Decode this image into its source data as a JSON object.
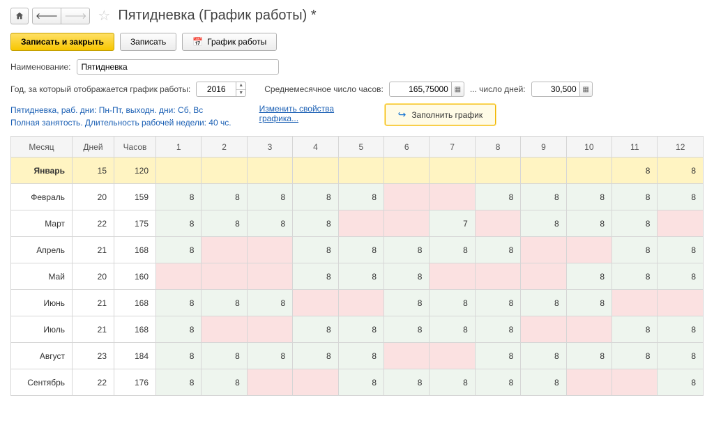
{
  "title": "Пятидневка (График работы) *",
  "toolbar": {
    "save_close": "Записать и закрыть",
    "save": "Записать",
    "schedule": "График работы"
  },
  "fields": {
    "name_label": "Наименование:",
    "name_value": "Пятидневка",
    "year_label": "Год, за который отображается график работы:",
    "year_value": "2016",
    "avg_hours_label": "Среднемесячное число часов:",
    "avg_hours_value": "165,75000",
    "days_label": "... число дней:",
    "days_value": "30,500"
  },
  "info": {
    "line1": "Пятидневка, раб. дни: Пн-Пт, выходн. дни: Сб, Вс",
    "line2": "Полная занятость. Длительность рабочей недели: 40 чс.",
    "link": "Изменить свойства графика...",
    "fill_btn": "Заполнить график"
  },
  "headers": {
    "month": "Месяц",
    "days": "Дней",
    "hours": "Часов"
  },
  "dayHeaders": [
    "1",
    "2",
    "3",
    "4",
    "5",
    "6",
    "7",
    "8",
    "9",
    "10",
    "11",
    "12"
  ],
  "rows": [
    {
      "month": "Январь",
      "days": "15",
      "hours": "120",
      "selected": true,
      "cells": [
        {
          "v": "",
          "c": ""
        },
        {
          "v": "",
          "c": ""
        },
        {
          "v": "",
          "c": ""
        },
        {
          "v": "",
          "c": ""
        },
        {
          "v": "",
          "c": ""
        },
        {
          "v": "",
          "c": ""
        },
        {
          "v": "",
          "c": ""
        },
        {
          "v": "",
          "c": ""
        },
        {
          "v": "",
          "c": ""
        },
        {
          "v": "",
          "c": ""
        },
        {
          "v": "8",
          "c": "w"
        },
        {
          "v": "8",
          "c": "w"
        }
      ]
    },
    {
      "month": "Февраль",
      "days": "20",
      "hours": "159",
      "cells": [
        {
          "v": "8",
          "c": "w"
        },
        {
          "v": "8",
          "c": "w"
        },
        {
          "v": "8",
          "c": "w"
        },
        {
          "v": "8",
          "c": "w"
        },
        {
          "v": "8",
          "c": "w"
        },
        {
          "v": "",
          "c": "h"
        },
        {
          "v": "",
          "c": "h"
        },
        {
          "v": "8",
          "c": "w"
        },
        {
          "v": "8",
          "c": "w"
        },
        {
          "v": "8",
          "c": "w"
        },
        {
          "v": "8",
          "c": "w"
        },
        {
          "v": "8",
          "c": "w"
        }
      ]
    },
    {
      "month": "Март",
      "days": "22",
      "hours": "175",
      "cells": [
        {
          "v": "8",
          "c": "w"
        },
        {
          "v": "8",
          "c": "w"
        },
        {
          "v": "8",
          "c": "w"
        },
        {
          "v": "8",
          "c": "w"
        },
        {
          "v": "",
          "c": "h"
        },
        {
          "v": "",
          "c": "h"
        },
        {
          "v": "7",
          "c": "w"
        },
        {
          "v": "",
          "c": "h"
        },
        {
          "v": "8",
          "c": "w"
        },
        {
          "v": "8",
          "c": "w"
        },
        {
          "v": "8",
          "c": "w"
        },
        {
          "v": "",
          "c": "h"
        }
      ]
    },
    {
      "month": "Апрель",
      "days": "21",
      "hours": "168",
      "cells": [
        {
          "v": "8",
          "c": "w"
        },
        {
          "v": "",
          "c": "h"
        },
        {
          "v": "",
          "c": "h"
        },
        {
          "v": "8",
          "c": "w"
        },
        {
          "v": "8",
          "c": "w"
        },
        {
          "v": "8",
          "c": "w"
        },
        {
          "v": "8",
          "c": "w"
        },
        {
          "v": "8",
          "c": "w"
        },
        {
          "v": "",
          "c": "h"
        },
        {
          "v": "",
          "c": "h"
        },
        {
          "v": "8",
          "c": "w"
        },
        {
          "v": "8",
          "c": "w"
        }
      ]
    },
    {
      "month": "Май",
      "days": "20",
      "hours": "160",
      "cells": [
        {
          "v": "",
          "c": "h"
        },
        {
          "v": "",
          "c": "h"
        },
        {
          "v": "",
          "c": "h"
        },
        {
          "v": "8",
          "c": "w"
        },
        {
          "v": "8",
          "c": "w"
        },
        {
          "v": "8",
          "c": "w"
        },
        {
          "v": "",
          "c": "h"
        },
        {
          "v": "",
          "c": "h"
        },
        {
          "v": "",
          "c": "h"
        },
        {
          "v": "8",
          "c": "w"
        },
        {
          "v": "8",
          "c": "w"
        },
        {
          "v": "8",
          "c": "w"
        }
      ]
    },
    {
      "month": "Июнь",
      "days": "21",
      "hours": "168",
      "cells": [
        {
          "v": "8",
          "c": "w"
        },
        {
          "v": "8",
          "c": "w"
        },
        {
          "v": "8",
          "c": "w"
        },
        {
          "v": "",
          "c": "h"
        },
        {
          "v": "",
          "c": "h"
        },
        {
          "v": "8",
          "c": "w"
        },
        {
          "v": "8",
          "c": "w"
        },
        {
          "v": "8",
          "c": "w"
        },
        {
          "v": "8",
          "c": "w"
        },
        {
          "v": "8",
          "c": "w"
        },
        {
          "v": "",
          "c": "h"
        },
        {
          "v": "",
          "c": "h"
        }
      ]
    },
    {
      "month": "Июль",
      "days": "21",
      "hours": "168",
      "cells": [
        {
          "v": "8",
          "c": "w"
        },
        {
          "v": "",
          "c": "h"
        },
        {
          "v": "",
          "c": "h"
        },
        {
          "v": "8",
          "c": "w"
        },
        {
          "v": "8",
          "c": "w"
        },
        {
          "v": "8",
          "c": "w"
        },
        {
          "v": "8",
          "c": "w"
        },
        {
          "v": "8",
          "c": "w"
        },
        {
          "v": "",
          "c": "h"
        },
        {
          "v": "",
          "c": "h"
        },
        {
          "v": "8",
          "c": "w"
        },
        {
          "v": "8",
          "c": "w"
        }
      ]
    },
    {
      "month": "Август",
      "days": "23",
      "hours": "184",
      "cells": [
        {
          "v": "8",
          "c": "w"
        },
        {
          "v": "8",
          "c": "w"
        },
        {
          "v": "8",
          "c": "w"
        },
        {
          "v": "8",
          "c": "w"
        },
        {
          "v": "8",
          "c": "w"
        },
        {
          "v": "",
          "c": "h"
        },
        {
          "v": "",
          "c": "h"
        },
        {
          "v": "8",
          "c": "w"
        },
        {
          "v": "8",
          "c": "w"
        },
        {
          "v": "8",
          "c": "w"
        },
        {
          "v": "8",
          "c": "w"
        },
        {
          "v": "8",
          "c": "w"
        }
      ]
    },
    {
      "month": "Сентябрь",
      "days": "22",
      "hours": "176",
      "cells": [
        {
          "v": "8",
          "c": "w"
        },
        {
          "v": "8",
          "c": "w"
        },
        {
          "v": "",
          "c": "h"
        },
        {
          "v": "",
          "c": "h"
        },
        {
          "v": "8",
          "c": "w"
        },
        {
          "v": "8",
          "c": "w"
        },
        {
          "v": "8",
          "c": "w"
        },
        {
          "v": "8",
          "c": "w"
        },
        {
          "v": "8",
          "c": "w"
        },
        {
          "v": "",
          "c": "h"
        },
        {
          "v": "",
          "c": "h"
        },
        {
          "v": "8",
          "c": "w"
        }
      ]
    }
  ]
}
